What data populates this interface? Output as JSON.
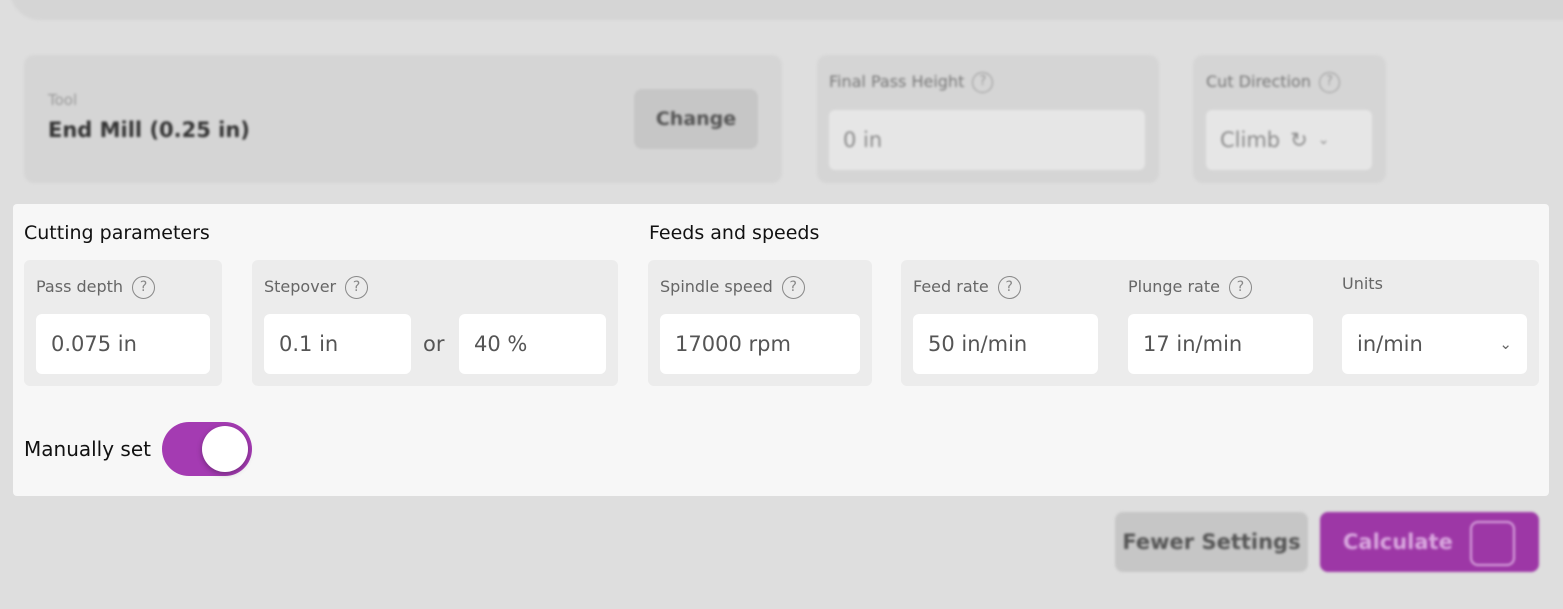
{
  "tool": {
    "label": "Tool",
    "name": "End Mill (0.25 in)",
    "change_label": "Change"
  },
  "final_pass": {
    "label": "Final Pass Height",
    "value": "0 in"
  },
  "cut_direction": {
    "label": "Cut Direction",
    "value": "Climb"
  },
  "cutting": {
    "title": "Cutting parameters",
    "pass_depth": {
      "label": "Pass depth",
      "value": "0.075 in"
    },
    "stepover": {
      "label": "Stepover",
      "value": "0.1 in",
      "or": "or",
      "percent": "40 %"
    }
  },
  "feeds": {
    "title": "Feeds and speeds",
    "spindle": {
      "label": "Spindle speed",
      "value": "17000 rpm"
    },
    "feed_rate": {
      "label": "Feed rate",
      "value": "50 in/min"
    },
    "plunge_rate": {
      "label": "Plunge rate",
      "value": "17 in/min"
    },
    "units": {
      "label": "Units",
      "value": "in/min"
    }
  },
  "manual": {
    "label": "Manually set",
    "on": true
  },
  "help_glyph": "?",
  "actions": {
    "fewer": "Fewer Settings",
    "calculate": "Calculate"
  },
  "colors": {
    "accent": "#a43bb2"
  }
}
